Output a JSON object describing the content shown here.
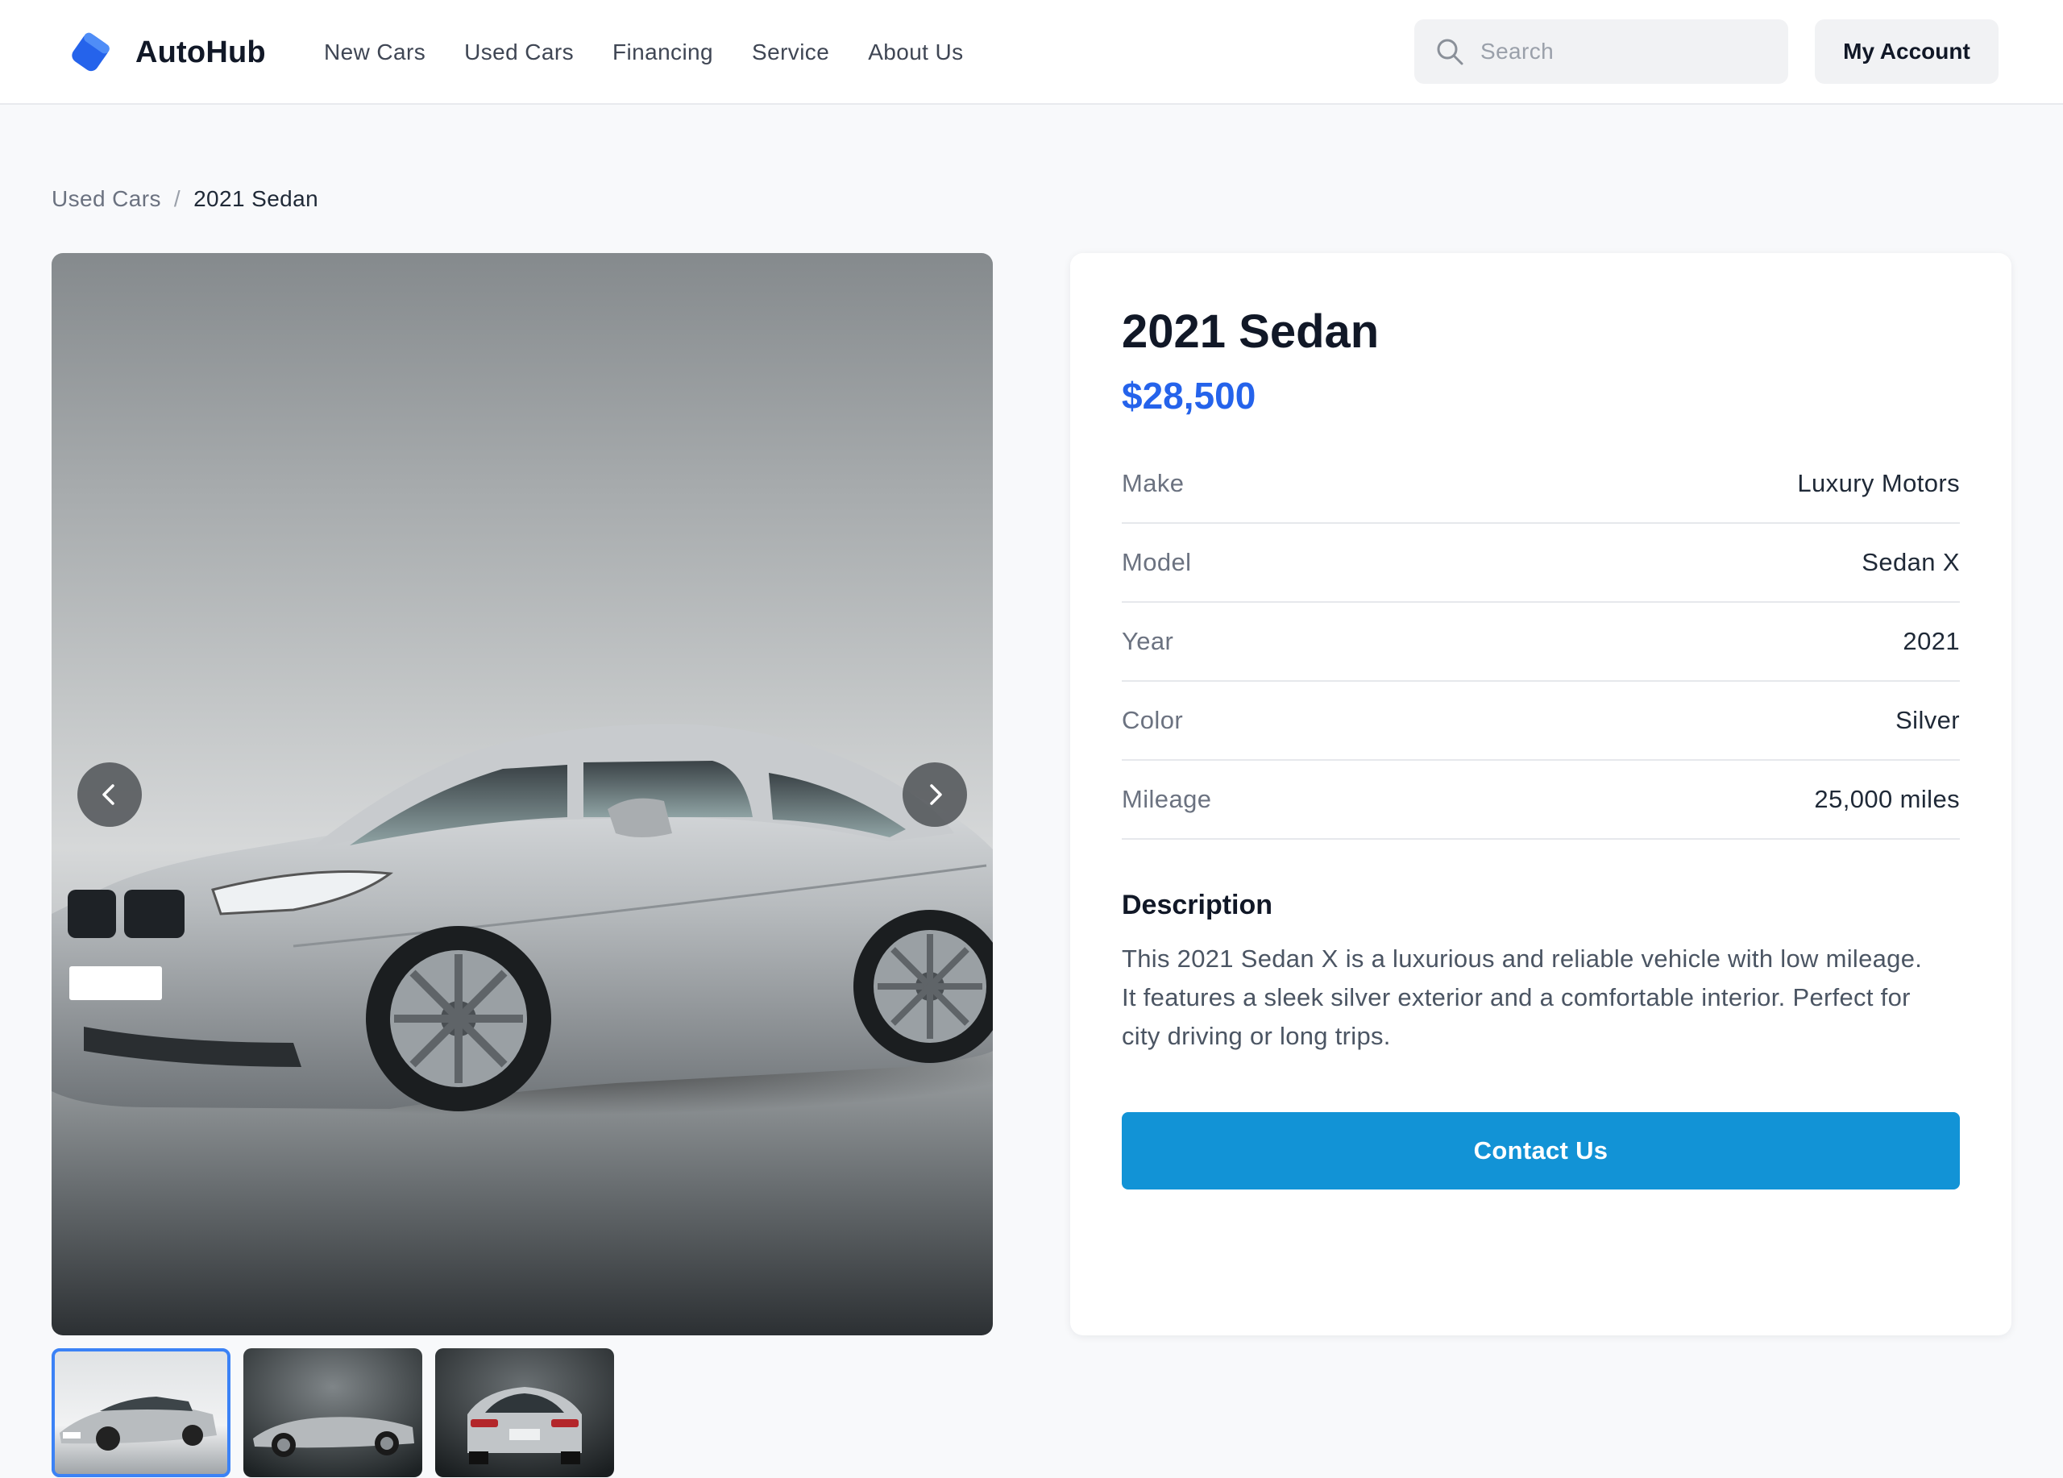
{
  "header": {
    "brand": "AutoHub",
    "nav": [
      "New Cars",
      "Used Cars",
      "Financing",
      "Service",
      "About Us"
    ],
    "search_placeholder": "Search",
    "account_label": "My Account"
  },
  "breadcrumb": {
    "parent": "Used Cars",
    "separator": "/",
    "current": "2021 Sedan"
  },
  "gallery": {
    "thumbnails": [
      "front-three-quarter",
      "side-convertible",
      "rear"
    ],
    "active_thumbnail": 0
  },
  "listing": {
    "title": "2021 Sedan",
    "price": "$28,500",
    "specs": [
      {
        "label": "Make",
        "value": "Luxury Motors"
      },
      {
        "label": "Model",
        "value": "Sedan X"
      },
      {
        "label": "Year",
        "value": "2021"
      },
      {
        "label": "Color",
        "value": "Silver"
      },
      {
        "label": "Mileage",
        "value": "25,000 miles"
      }
    ],
    "description_heading": "Description",
    "description": "This 2021 Sedan X is a luxurious and reliable vehicle with low mileage. It features a sleek silver exterior and a comfortable interior. Perfect for city driving or long trips.",
    "cta_label": "Contact Us"
  },
  "colors": {
    "accent_price": "#2563eb",
    "cta": "#1293d6",
    "logo": "#2563eb",
    "active_thumb_border": "#3b82f6"
  },
  "icons": {
    "logo": "tilted-square-logo-icon",
    "search": "search-icon",
    "prev": "chevron-left-icon",
    "next": "chevron-right-icon"
  }
}
